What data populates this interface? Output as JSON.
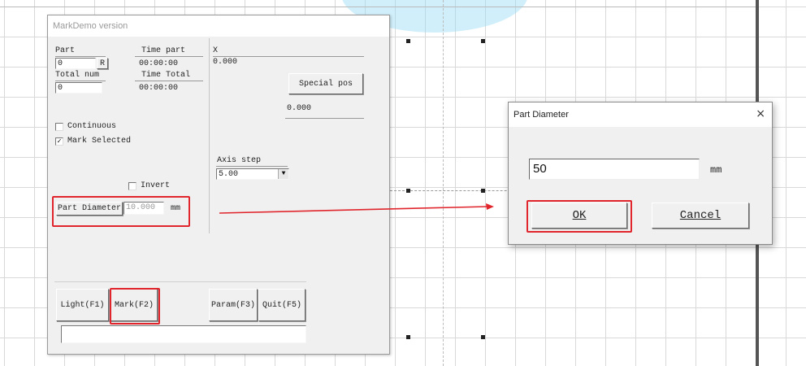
{
  "main_window": {
    "title": "MarkDemo version",
    "part_label": "Part",
    "part_value": "0",
    "reset_label": "R",
    "time_part_label": "Time part",
    "time_part_value": "00:00:00",
    "total_num_label": "Total num",
    "total_num_value": "0",
    "time_total_label": "Time Total",
    "time_total_value": "00:00:00",
    "continuous_label": "Continuous",
    "continuous_checked": false,
    "mark_selected_label": "Mark Selected",
    "mark_selected_checked": true,
    "mark_selected_check_glyph": "✓",
    "invert_label": "Invert",
    "invert_checked": false,
    "part_diameter_button": "Part Diameter",
    "part_diameter_value": "10.000",
    "part_diameter_unit": "mm",
    "x_label": "X",
    "x_value": "0.000",
    "special_pos_button": "Special pos",
    "special_pos_value": "0.000",
    "axis_step_label": "Axis step",
    "axis_step_value": "5.00",
    "combo_arrow": "▼",
    "light_button": "Light(F1)",
    "mark_button": "Mark(F2)",
    "param_button": "Param(F3)",
    "quit_button": "Quit(F5)"
  },
  "dialog": {
    "title": "Part Diameter",
    "close_glyph": "×",
    "input_value": "50",
    "unit": "mm",
    "ok_button": "OK",
    "cancel_button": "Cancel"
  },
  "colors": {
    "highlight_red": "#e0262c",
    "watermark": "#96dcf5"
  }
}
